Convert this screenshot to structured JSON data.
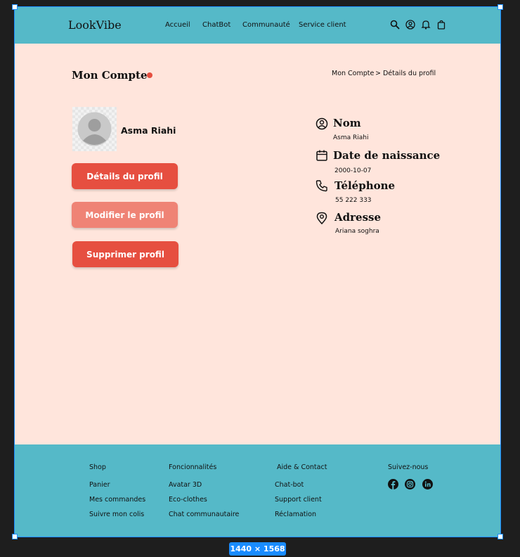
{
  "header": {
    "logo": "LookVibe",
    "nav": [
      "Accueil",
      "ChatBot",
      "Communauté",
      "Service client"
    ],
    "icons": [
      "search-icon",
      "user-icon",
      "bell-icon",
      "bag-icon"
    ]
  },
  "page": {
    "title": "Mon Compte",
    "breadcrumb": {
      "root": "Mon Compte",
      "current": "> Détails du profil"
    }
  },
  "profile": {
    "name": "Asma Riahi"
  },
  "buttons": {
    "details": "Détails du profil",
    "edit": "Modifier le profil",
    "delete": "Supprimer profil"
  },
  "info": {
    "name_label": "Nom",
    "name_value": "Asma Riahi",
    "birth_label": "Date de naissance",
    "birth_value": "2000-10-07",
    "phone_label": "Téléphone",
    "phone_value": "55 222 333",
    "address_label": "Adresse",
    "address_value": "Ariana soghra"
  },
  "footer": {
    "shop": {
      "title": "Shop",
      "links": [
        "Panier",
        "Mes commandes",
        "Suivre mon colis"
      ]
    },
    "features": {
      "title": "Foncionnalités",
      "links": [
        "Avatar 3D",
        "Eco-clothes",
        "Chat communautaire"
      ]
    },
    "help": {
      "title": "Aide & Contact",
      "links": [
        "Chat-bot",
        "Support client",
        "Réclamation"
      ]
    },
    "social": {
      "title": "Suivez-nous",
      "icons": [
        "facebook-icon",
        "instagram-icon",
        "linkedin-icon"
      ]
    }
  },
  "canvas": {
    "dimensions": "1440 × 1568"
  },
  "colors": {
    "header_bg": "#55b9c8",
    "page_bg": "#ffe5dc",
    "accent": "#e64f40",
    "accent_light": "#ef8375",
    "selection": "#1a8cff"
  }
}
